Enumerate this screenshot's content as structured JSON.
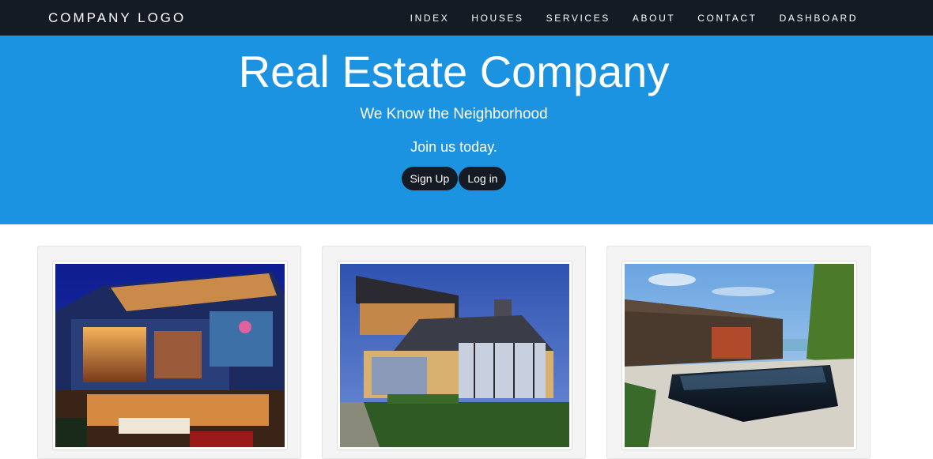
{
  "navbar": {
    "brand": "COMPANY LOGO",
    "links": [
      "INDEX",
      "HOUSES",
      "SERVICES",
      "ABOUT",
      "CONTACT",
      "DASHBOARD"
    ]
  },
  "hero": {
    "title": "Real Estate Company",
    "subtitle": "We Know the Neighborhood",
    "cta_text": "Join us today.",
    "signup_label": "Sign Up",
    "login_label": "Log in"
  },
  "colors": {
    "navbar_bg": "#151b24",
    "hero_bg": "#1b93e1",
    "button_bg": "#151b24",
    "card_bg": "#f4f4f4"
  },
  "cards": [
    {
      "image": "modern-glass-house-night-photo"
    },
    {
      "image": "modern-house-dusk-lawn-photo"
    },
    {
      "image": "wood-house-reflecting-pool-photo"
    }
  ]
}
